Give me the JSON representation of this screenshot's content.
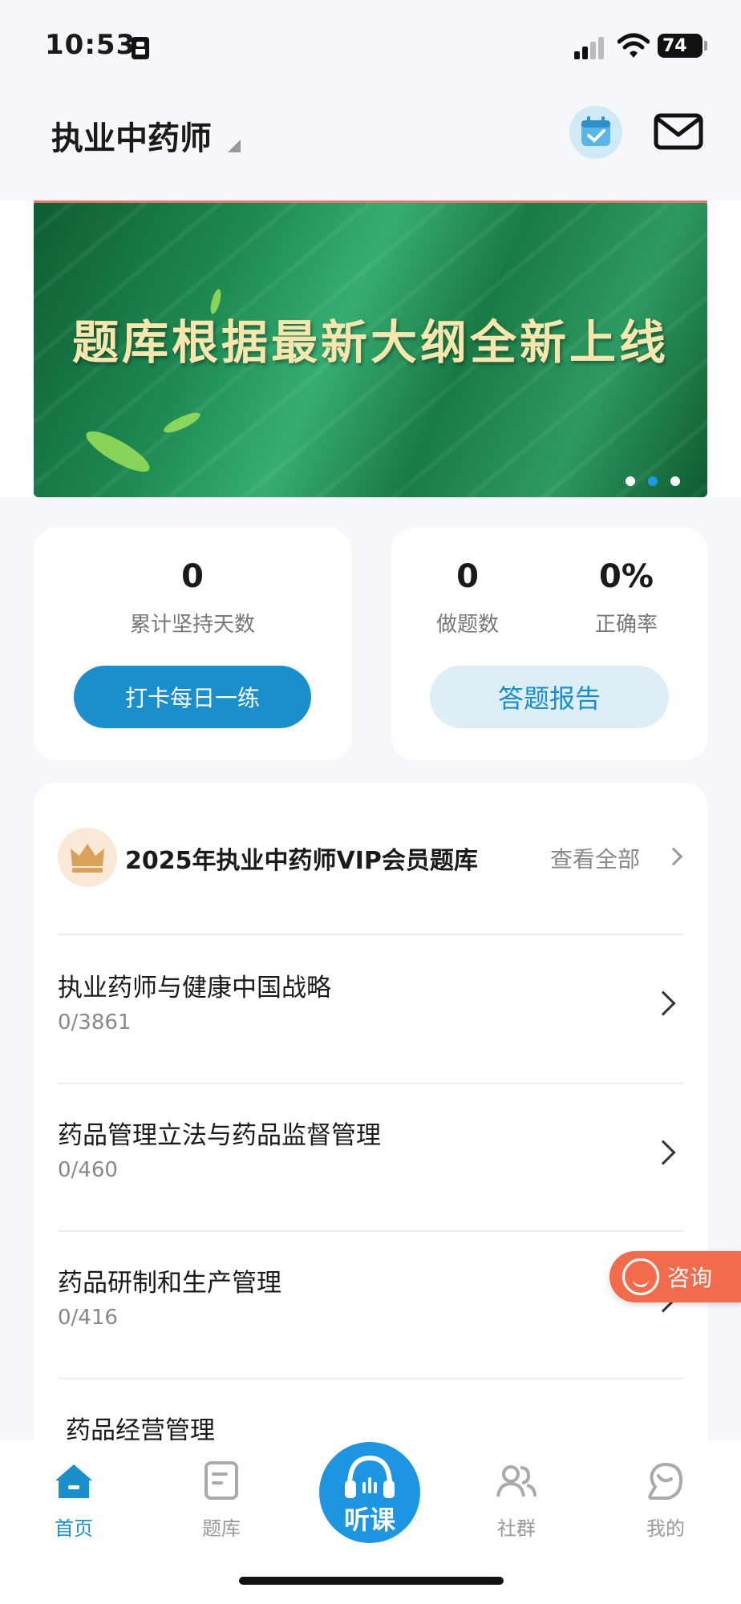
{
  "status_bar": {
    "time": "10:53",
    "battery": "74"
  },
  "header": {
    "title": "执业中药师"
  },
  "banner": {
    "headline": "题库根据最新大纲全新上线",
    "slides": 3,
    "active_slide": 2
  },
  "stats": {
    "days": {
      "value": "0",
      "label": "累计坚持天数",
      "button": "打卡每日一练"
    },
    "questions": {
      "value": "0",
      "label": "做题数"
    },
    "accuracy": {
      "value": "0%",
      "label": "正确率"
    },
    "report_button": "答题报告"
  },
  "bank": {
    "title": "2025年执业中药师VIP会员题库",
    "view_all": "查看全部",
    "items": [
      {
        "title": "执业药师与健康中国战略",
        "count": "0/3861"
      },
      {
        "title": "药品管理立法与药品监督管理",
        "count": "0/460"
      },
      {
        "title": "药品研制和生产管理",
        "count": "0/416"
      },
      {
        "title": "药品经营管理",
        "count": ""
      }
    ]
  },
  "consult": {
    "label": "咨询"
  },
  "tabbar": {
    "home": "首页",
    "bank": "题库",
    "listen": "听课",
    "community": "社群",
    "mine": "我的"
  },
  "colors": {
    "accent": "#1b8fcb",
    "consult": "#f26b4d",
    "banner_text": "#f7e7ae"
  }
}
